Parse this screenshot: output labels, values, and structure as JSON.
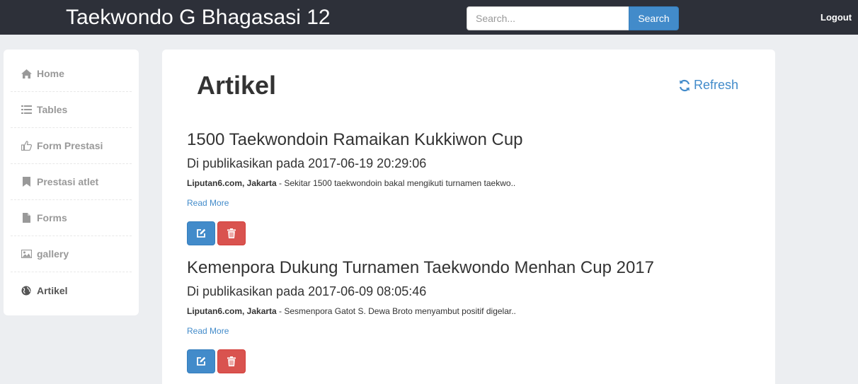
{
  "header": {
    "brand": "Taekwondo G Bhagasasi 12",
    "search_placeholder": "Search...",
    "search_button": "Search",
    "logout": "Logout"
  },
  "sidebar": {
    "items": [
      {
        "label": "Home",
        "icon": "home-icon"
      },
      {
        "label": "Tables",
        "icon": "list-icon"
      },
      {
        "label": "Form Prestasi",
        "icon": "thumbs-up-icon"
      },
      {
        "label": "Prestasi atlet",
        "icon": "bookmark-icon"
      },
      {
        "label": "Forms",
        "icon": "file-icon"
      },
      {
        "label": "gallery",
        "icon": "picture-icon"
      },
      {
        "label": "Artikel",
        "icon": "globe-icon",
        "active": true
      }
    ]
  },
  "main": {
    "title": "Artikel",
    "refresh": "Refresh",
    "articles": [
      {
        "title": "1500 Taekwondoin Ramaikan Kukkiwon Cup",
        "date": "Di publikasikan pada 2017-06-19 20:29:06",
        "source": "Liputan6.com, Jakarta",
        "excerpt": " - Sekitar 1500 taekwondoin bakal mengikuti turnamen taekwo..",
        "read_more": "Read More"
      },
      {
        "title": "Kemenpora Dukung Turnamen Taekwondo Menhan Cup 2017",
        "date": "Di publikasikan pada 2017-06-09 08:05:46",
        "source": "Liputan6.com, Jakarta",
        "excerpt": " - Sesmenpora Gatot S. Dewa Broto menyambut positif digelar..",
        "read_more": "Read More"
      }
    ]
  },
  "colors": {
    "navbar": "#2d3039",
    "primary": "#428bca",
    "danger": "#d9534f",
    "background": "#eceef1"
  }
}
